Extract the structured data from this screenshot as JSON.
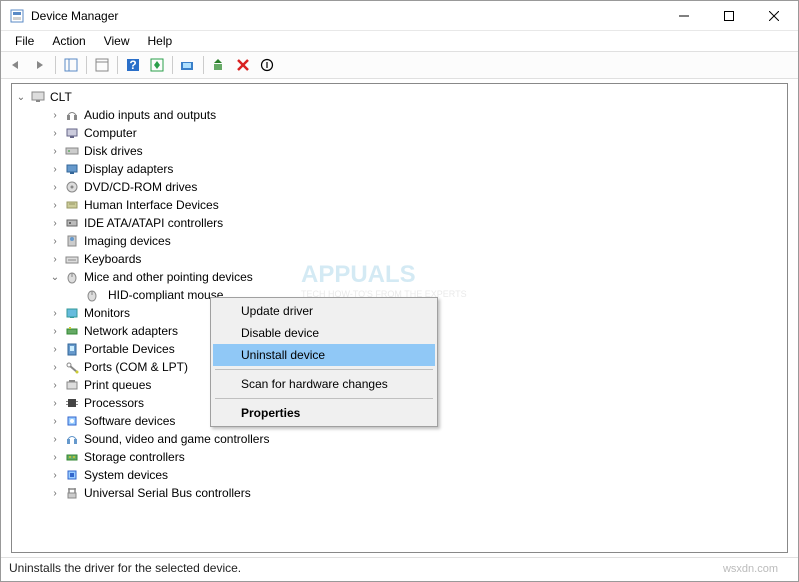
{
  "window": {
    "title": "Device Manager"
  },
  "menu": {
    "file": "File",
    "action": "Action",
    "view": "View",
    "help": "Help"
  },
  "tree": {
    "root": "CLT",
    "items": [
      "Audio inputs and outputs",
      "Computer",
      "Disk drives",
      "Display adapters",
      "DVD/CD-ROM drives",
      "Human Interface Devices",
      "IDE ATA/ATAPI controllers",
      "Imaging devices",
      "Keyboards",
      "Mice and other pointing devices",
      "Monitors",
      "Network adapters",
      "Portable Devices",
      "Ports (COM & LPT)",
      "Print queues",
      "Processors",
      "Software devices",
      "Sound, video and game controllers",
      "Storage controllers",
      "System devices",
      "Universal Serial Bus controllers"
    ],
    "selected_child": "HID-compliant mouse"
  },
  "context_menu": {
    "update": "Update driver",
    "disable": "Disable device",
    "uninstall": "Uninstall device",
    "scan": "Scan for hardware changes",
    "properties": "Properties"
  },
  "status": "Uninstalls the driver for the selected device.",
  "watermark": "wsxdn.com",
  "watermark2": {
    "a": "APPUALS",
    "b": "TECH HOW-TO'S FROM THE EXPERTS"
  }
}
